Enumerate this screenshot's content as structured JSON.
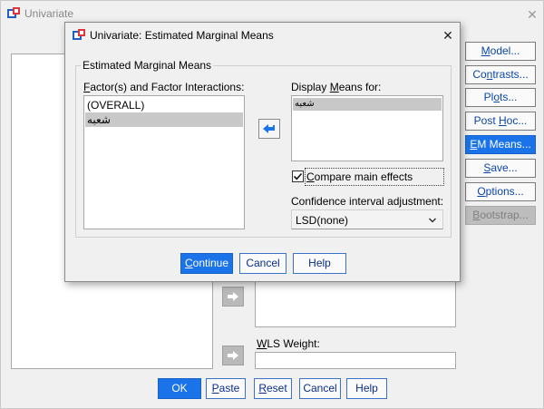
{
  "background_window": {
    "title": "Univariate",
    "side_buttons": [
      {
        "pre": "",
        "u": "M",
        "post": "odel..."
      },
      {
        "pre": "Co",
        "u": "n",
        "post": "trasts..."
      },
      {
        "pre": "Pl",
        "u": "o",
        "post": "ts..."
      },
      {
        "pre": "Post ",
        "u": "H",
        "post": "oc..."
      },
      {
        "pre": "",
        "u": "E",
        "post": "M Means..."
      },
      {
        "pre": "",
        "u": "S",
        "post": "ave..."
      },
      {
        "pre": "",
        "u": "O",
        "post": "ptions..."
      },
      {
        "pre": "",
        "u": "B",
        "post": "ootstrap..."
      }
    ],
    "wls": {
      "pre": "",
      "u": "W",
      "post": "LS Weight:"
    },
    "bottom_buttons": {
      "ok": "OK",
      "paste": {
        "pre": "",
        "u": "P",
        "post": "aste"
      },
      "reset": {
        "pre": "",
        "u": "R",
        "post": "eset"
      },
      "cancel": "Cancel",
      "help": "Help"
    }
  },
  "dialog": {
    "title": "Univariate: Estimated Marginal Means",
    "group_title": "Estimated Marginal Means",
    "factors_label": {
      "pre": "",
      "u": "F",
      "post": "actor(s) and Factor Interactions:"
    },
    "factors_items": [
      "(OVERALL)",
      "شعبه"
    ],
    "display_label": {
      "pre": "Display ",
      "u": "M",
      "post": "eans for:"
    },
    "display_items": [
      "شعبه"
    ],
    "compare": {
      "pre": "",
      "u": "C",
      "post": "ompare main effects",
      "checked": true
    },
    "ci_label": "Confidence interval adjustment:",
    "ci_value": "LSD(none)",
    "continue": {
      "pre": "",
      "u": "C",
      "post": "ontinue"
    },
    "cancel": "Cancel",
    "help": "Help"
  },
  "colors": {
    "accent": "#1a73e8",
    "link_text": "#0b46a8",
    "selected_row": "#c8c8c8"
  }
}
